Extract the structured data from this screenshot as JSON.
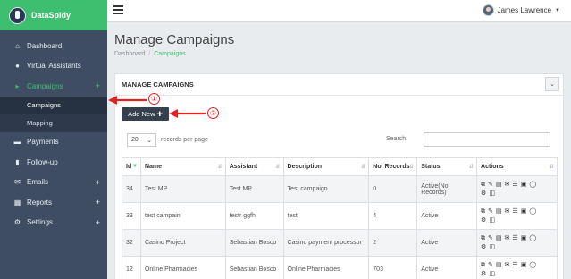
{
  "app": {
    "brand": "DataSpidy"
  },
  "sidebar": {
    "items": [
      {
        "label": "Dashboard",
        "icon": "home-icon",
        "glyph": "⌂"
      },
      {
        "label": "Virtual Assistants",
        "icon": "users-icon",
        "glyph": "👥"
      },
      {
        "label": "Campaigns",
        "icon": "megaphone-icon",
        "glyph": "📣",
        "plus": "+"
      },
      {
        "label": "Payments",
        "icon": "credit-card-icon",
        "glyph": "▬"
      },
      {
        "label": "Follow-up",
        "icon": "bookmark-icon",
        "glyph": "▮"
      },
      {
        "label": "Emails",
        "icon": "inbox-icon",
        "glyph": "✉",
        "plus": "+"
      },
      {
        "label": "Reports",
        "icon": "chart-icon",
        "glyph": "▦",
        "plus": "+"
      },
      {
        "label": "Settings",
        "icon": "gear-icon",
        "glyph": "⚙",
        "plus": "+"
      }
    ],
    "sub": [
      "Campaigns",
      "Mapping"
    ]
  },
  "topbar": {
    "user": "James Lawrence"
  },
  "page": {
    "title": "Manage Campaigns",
    "breadcrumb": [
      "Dashboard",
      "Campaigns"
    ]
  },
  "card": {
    "header": "MANAGE CAMPAIGNS",
    "add_label": "Add New",
    "page_size": "20",
    "records_label": "records per page",
    "search_label": "Search:"
  },
  "table": {
    "columns": [
      "Id",
      "Name",
      "Assistant",
      "Description",
      "No. Records",
      "Status",
      "Actions"
    ],
    "rows": [
      [
        "34",
        "Test MP",
        "Test MP",
        "Test campaign",
        "0",
        "Active(No Records)"
      ],
      [
        "33",
        "test campain",
        "testr ggfh",
        "test",
        "4",
        "Active"
      ],
      [
        "32",
        "Casino Project",
        "Sebastian Bosco",
        "Casino payment processor",
        "2",
        "Active"
      ],
      [
        "12",
        "Online Pharmacies",
        "Sebastian Bosco",
        "Online Pharmacies",
        "703",
        "Active"
      ]
    ]
  },
  "annotations": [
    "①",
    "②"
  ],
  "colors": {
    "accent": "#3ebf6f",
    "sidebar": "#3f4d63",
    "annotation": "#e02424"
  }
}
